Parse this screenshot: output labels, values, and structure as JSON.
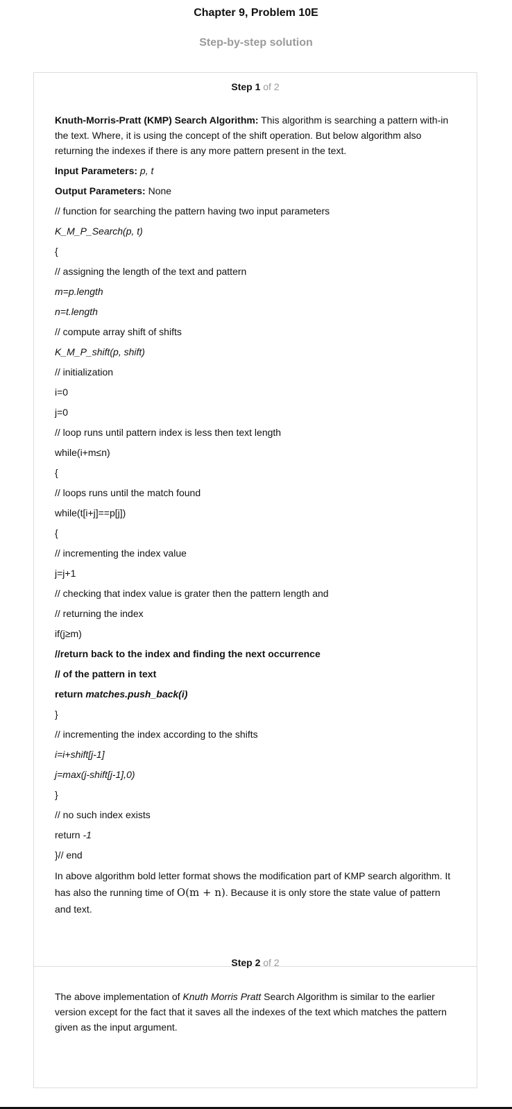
{
  "header": {
    "title": "Chapter 9, Problem 10E",
    "subtitle": "Step-by-step solution"
  },
  "steps": [
    {
      "step_label": "Step 1",
      "of_label": "of 2",
      "intro_bold": "Knuth-Morris-Pratt (KMP) Search Algorithm:",
      "intro_text": " This algorithm is searching a pattern with-in the text. Where, it is using the concept of the shift operation. But below algorithm also returning the indexes if there is any more pattern present in the text.",
      "input_label": "Input Parameters:",
      "input_value": " p, t",
      "output_label": "Output Parameters:",
      "output_value": " None",
      "code": {
        "c1": "// function for searching the pattern having two input parameters",
        "c2": "K_M_P_Search(p, t)",
        "c3": "{",
        "c4": "// assigning the length of the text and pattern",
        "c5": "m=p.length",
        "c6": "n=t.length",
        "c7": "// compute array shift of shifts",
        "c8": "K_M_P_shift(p, shift)",
        "c9": "// initialization",
        "c10": "i=0",
        "c11": "j=0",
        "c12": "// loop runs until pattern index is less then text length",
        "c13": "while(i+m≤n)",
        "c14": "{",
        "c15": "// loops runs until the match found",
        "c16": "while(t[i+j]==p[j])",
        "c17": "{",
        "c18": "// incrementing the index value",
        "c19": "j=j+1",
        "c20": "// checking that index value is grater then the pattern length and",
        "c21": "// returning the index",
        "c22": "if(j≥m)",
        "c23": "//return back to the index and finding the next occurrence",
        "c24": "// of the pattern in text",
        "c25a": "return ",
        "c25b": "matches.push_back(i)",
        "c26": "}",
        "c27": "// incrementing the index according to the shifts",
        "c28": "i=i+shift[j-1]",
        "c29": "j=max(j-shift[j-1],0)",
        "c30": "}",
        "c31": "// no such index exists",
        "c32a": "return ",
        "c32b": "-1",
        "c33": "}// end"
      },
      "closing_a": "In above algorithm bold letter format shows the modification part of KMP search algorithm. It has also the running time of ",
      "closing_math": "O(m + n)",
      "closing_b": ". Because it is only store the state value of pattern and text."
    },
    {
      "step_label": "Step 2",
      "of_label": "of 2",
      "text_a": "The above implementation of ",
      "text_italic": "Knuth Morris Pratt",
      "text_b": " Search Algorithm is similar to the earlier version except for the fact that it saves all the indexes of the text which matches the pattern given as the input argument."
    }
  ]
}
